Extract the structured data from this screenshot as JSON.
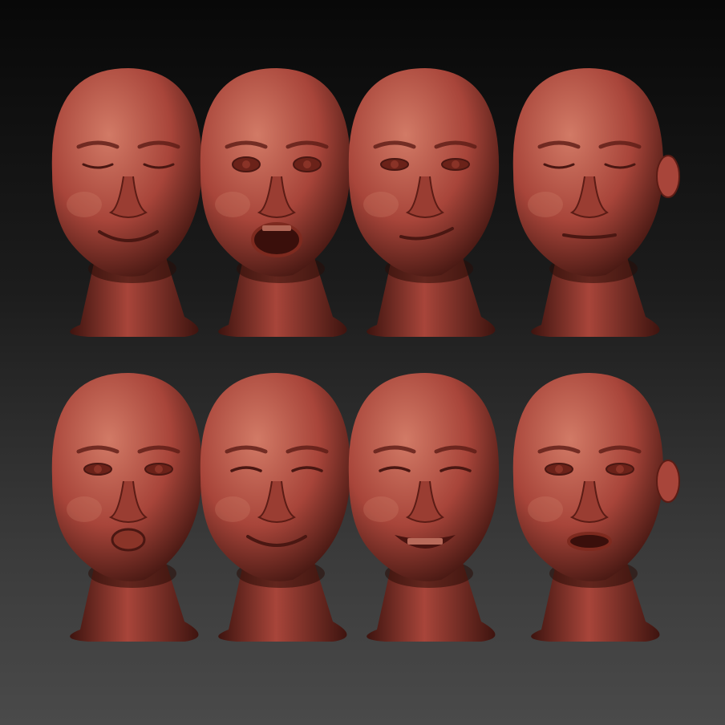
{
  "scene": {
    "background_top": "#080808",
    "background_bottom": "#4a4a4a",
    "material_color": "#a8453a",
    "material_highlight": "#d27a66",
    "material_shadow": "#3e140f"
  },
  "rows": [
    {
      "heads": [
        {
          "expression": "eyes-closed-smile",
          "mouth": "smile",
          "eyes": "closed"
        },
        {
          "expression": "surprised-open-mouth",
          "mouth": "open",
          "eyes": "wide"
        },
        {
          "expression": "smirk",
          "mouth": "smirk",
          "eyes": "open"
        },
        {
          "expression": "eyes-closed-calm",
          "mouth": "closed",
          "eyes": "closed"
        }
      ]
    },
    {
      "heads": [
        {
          "expression": "pout",
          "mouth": "pout",
          "eyes": "open"
        },
        {
          "expression": "squint-smile",
          "mouth": "smile",
          "eyes": "squint"
        },
        {
          "expression": "grin",
          "mouth": "grin",
          "eyes": "squint"
        },
        {
          "expression": "talking",
          "mouth": "open-small",
          "eyes": "open"
        }
      ]
    }
  ]
}
